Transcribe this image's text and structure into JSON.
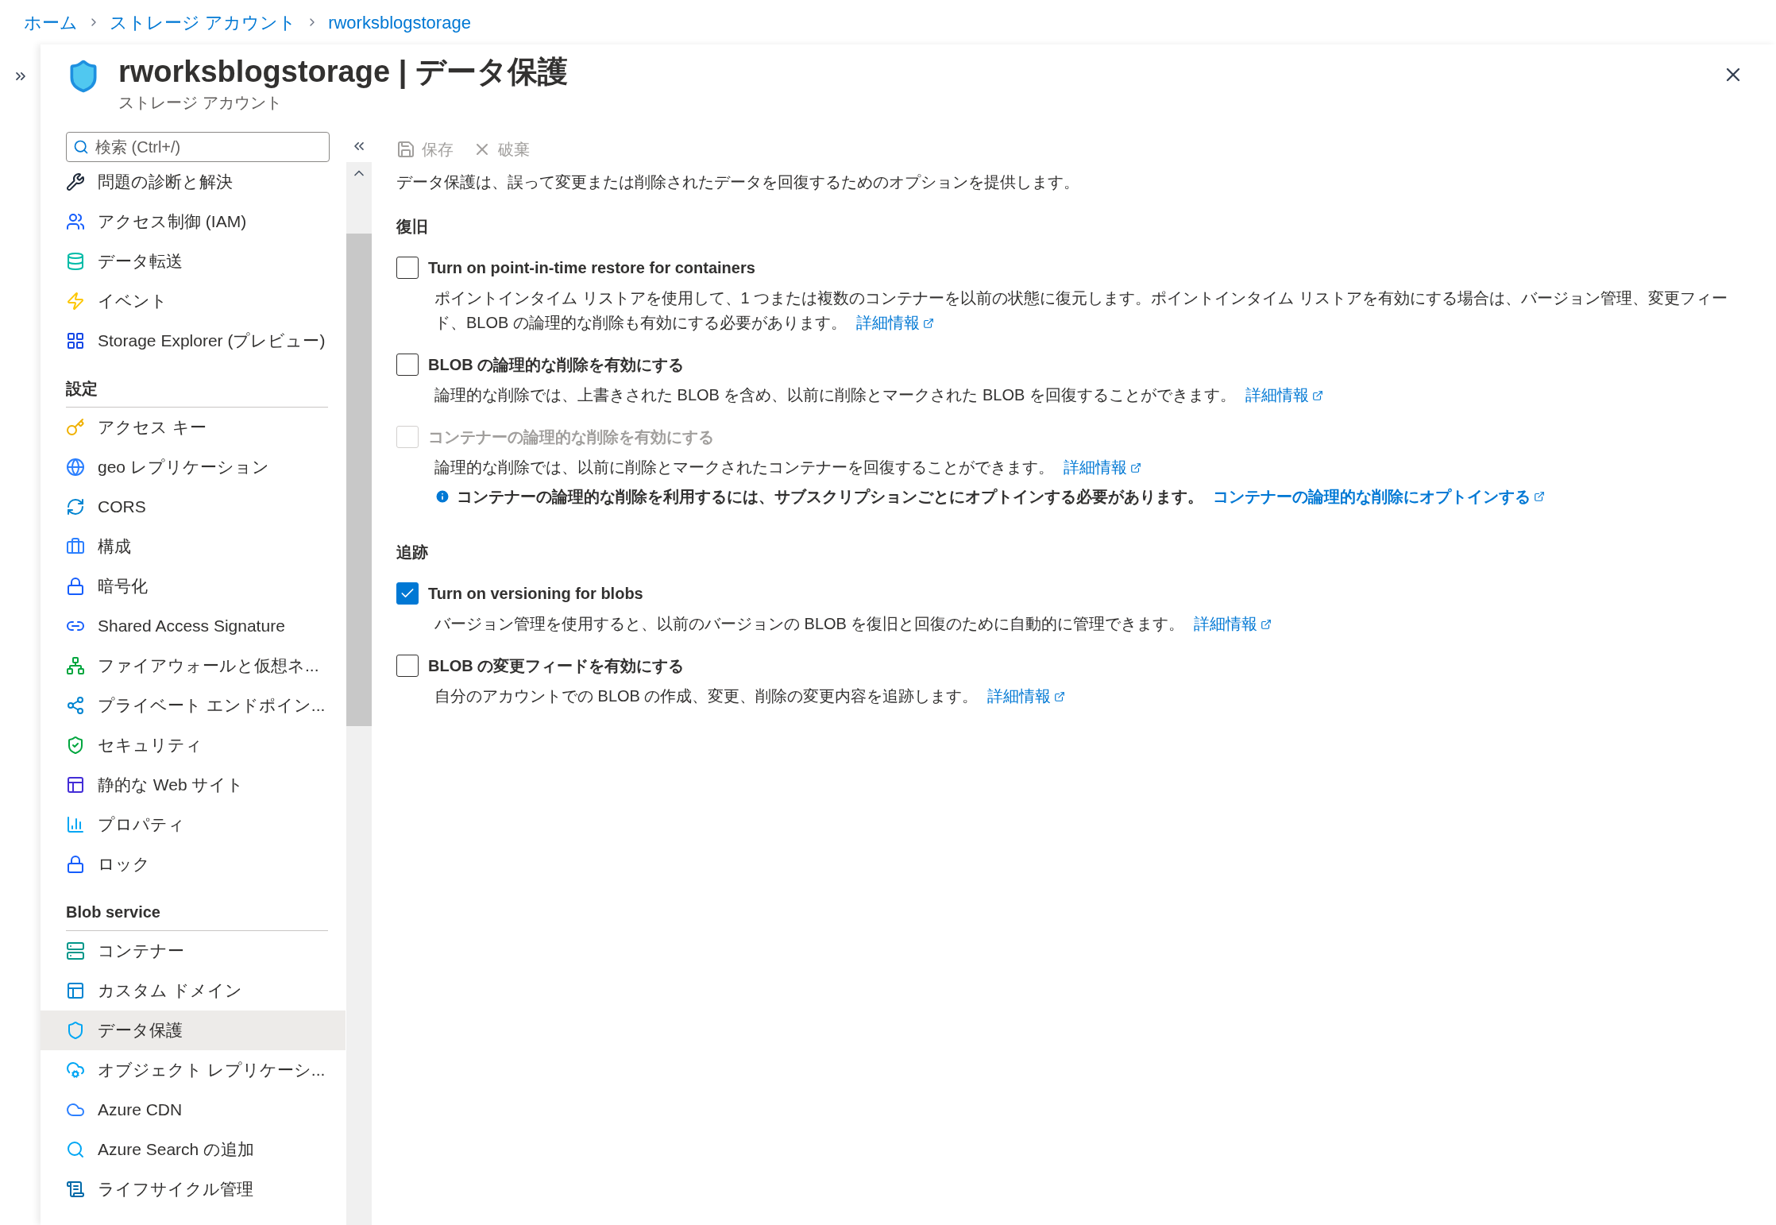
{
  "breadcrumb": [
    "ホーム",
    "ストレージ アカウント",
    "rworksblogstorage"
  ],
  "header": {
    "title": "rworksblogstorage | データ保護",
    "subtitle": "ストレージ アカウント"
  },
  "sidebar": {
    "search": {
      "placeholder": "検索 (Ctrl+/)"
    },
    "groups": [
      {
        "items": [
          {
            "label": "問題の診断と解決",
            "selected": false
          },
          {
            "label": "アクセス制御 (IAM)",
            "selected": false
          },
          {
            "label": "データ転送",
            "selected": false
          },
          {
            "label": "イベント",
            "selected": false
          },
          {
            "label": "Storage Explorer (プレビュー)",
            "selected": false
          }
        ]
      },
      {
        "heading": "設定",
        "items": [
          {
            "label": "アクセス キー",
            "selected": false
          },
          {
            "label": "geo レプリケーション",
            "selected": false
          },
          {
            "label": "CORS",
            "selected": false
          },
          {
            "label": "構成",
            "selected": false
          },
          {
            "label": "暗号化",
            "selected": false
          },
          {
            "label": "Shared Access Signature",
            "selected": false
          },
          {
            "label": "ファイアウォールと仮想ネ...",
            "selected": false
          },
          {
            "label": "プライベート エンドポイン...",
            "selected": false
          },
          {
            "label": "セキュリティ",
            "selected": false
          },
          {
            "label": "静的な Web サイト",
            "selected": false
          },
          {
            "label": "プロパティ",
            "selected": false
          },
          {
            "label": "ロック",
            "selected": false
          }
        ]
      },
      {
        "heading": "Blob service",
        "items": [
          {
            "label": "コンテナー",
            "selected": false
          },
          {
            "label": "カスタム ドメイン",
            "selected": false
          },
          {
            "label": "データ保護",
            "selected": true
          },
          {
            "label": "オブジェクト レプリケーシ...",
            "selected": false
          },
          {
            "label": "Azure CDN",
            "selected": false
          },
          {
            "label": "Azure Search の追加",
            "selected": false
          },
          {
            "label": "ライフサイクル管理",
            "selected": false
          }
        ]
      }
    ]
  },
  "toolbar": [
    {
      "kind": "save",
      "label": "保存",
      "disabled": true
    },
    {
      "kind": "discard",
      "label": "破棄",
      "disabled": true
    }
  ],
  "intro": "データ保護は、誤って変更または削除されたデータを回復するためのオプションを提供します。",
  "sections": [
    {
      "heading": "復旧",
      "options": [
        {
          "label": "Turn on point-in-time restore for containers",
          "checked": false,
          "disabled": false,
          "description": "ポイントインタイム リストアを使用して、1 つまたは複数のコンテナーを以前の状態に復元します。ポイントインタイム リストアを有効にする場合は、バージョン管理、変更フィード、BLOB の論理的な削除も有効にする必要があります。",
          "link": "詳細情報"
        },
        {
          "label": "BLOB の論理的な削除を有効にする",
          "checked": false,
          "disabled": false,
          "description": "論理的な削除では、上書きされた BLOB を含め、以前に削除とマークされた BLOB を回復することができます。",
          "link": "詳細情報"
        },
        {
          "label": "コンテナーの論理的な削除を有効にする",
          "checked": false,
          "disabled": true,
          "description": "論理的な削除では、以前に削除とマークされたコンテナーを回復することができます。",
          "link": "詳細情報",
          "note": {
            "text": "コンテナーの論理的な削除を利用するには、サブスクリプションごとにオプトインする必要があります。",
            "link": "コンテナーの論理的な削除にオプトインする"
          }
        }
      ]
    },
    {
      "heading": "追跡",
      "options": [
        {
          "label": "Turn on versioning for blobs",
          "checked": true,
          "disabled": false,
          "description": "バージョン管理を使用すると、以前のバージョンの BLOB を復旧と回復のために自動的に管理できます。",
          "link": "詳細情報"
        },
        {
          "label": "BLOB の変更フィードを有効にする",
          "checked": false,
          "disabled": false,
          "description": "自分のアカウントでの BLOB の作成、変更、削除の変更内容を追跡します。",
          "link": "詳細情報"
        }
      ]
    }
  ]
}
